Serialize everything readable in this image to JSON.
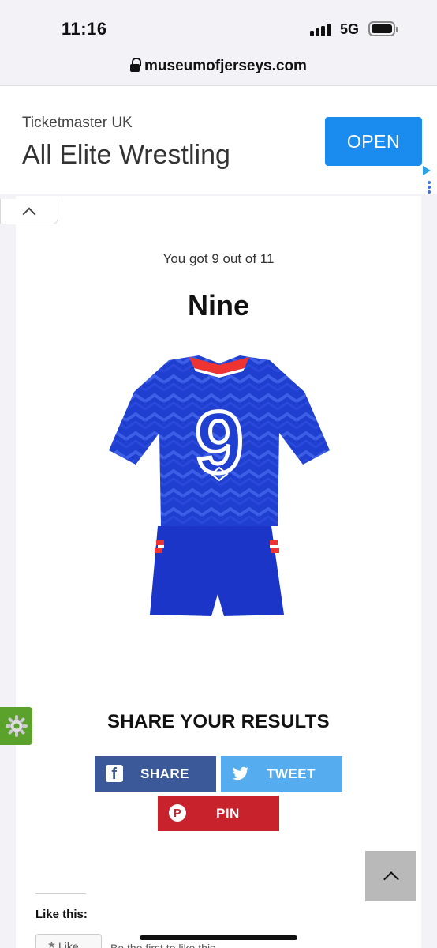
{
  "status_bar": {
    "time": "11:16",
    "network": "5G"
  },
  "browser": {
    "url": "museumofjerseys.com"
  },
  "ad": {
    "advertiser": "Ticketmaster UK",
    "title": "All Elite Wrestling",
    "cta": "OPEN"
  },
  "quiz": {
    "score_text": "You got 9 out of 11",
    "result_title": "Nine",
    "kit_number": "9"
  },
  "share": {
    "heading": "SHARE YOUR RESULTS",
    "facebook_label": "SHARE",
    "twitter_label": "TWEET",
    "pinterest_label": "PIN"
  },
  "like": {
    "heading": "Like this:",
    "button_label": "Like",
    "first_text": "Be the first to like this."
  },
  "colors": {
    "facebook": "#3b5998",
    "twitter": "#55acee",
    "pinterest": "#c8232c",
    "ad_button": "#1a8cf0",
    "kit_blue": "#1f3fd0",
    "widget_green": "#5ba22c"
  },
  "icons": [
    "lock-icon",
    "signal-icon",
    "battery-icon",
    "chevron-up-icon",
    "facebook-icon",
    "twitter-icon",
    "pinterest-icon",
    "gear-icon",
    "ad-choices-icon"
  ]
}
